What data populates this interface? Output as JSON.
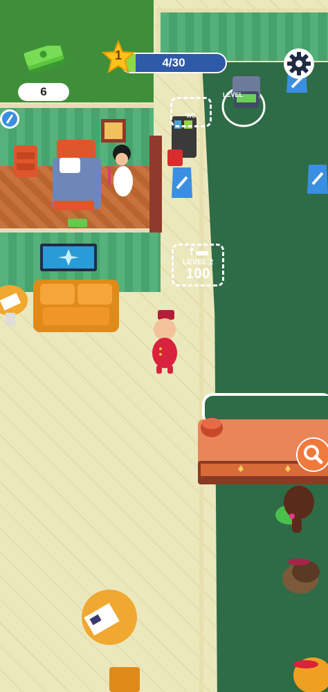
{
  "hud": {
    "cash_amount": "6",
    "player_level": "1",
    "xp_progress_text": "4/30",
    "xp_progress_fraction": 0.133
  },
  "markers": {
    "upgrade_level_text": "LEVEL 2",
    "upgrade_cost": "100",
    "wc_label": "WC",
    "level_badge_text": "LEVEL"
  },
  "colors": {
    "carpet": "#2e6b47",
    "wall_green": "#53b07a",
    "room_floor": "#c8733f",
    "hud_blue": "#2f5aa7",
    "progress_green": "#8ed94a",
    "star_yellow": "#ffc21a",
    "search_orange": "#f07a3c"
  },
  "icons": {
    "cash": "cash-stack-icon",
    "star": "star-icon",
    "settings": "gear-icon",
    "search": "magnifier-icon",
    "wet_floor": "wet-floor-sign-icon",
    "bed_upgrade": "bed-arrow-icon"
  }
}
